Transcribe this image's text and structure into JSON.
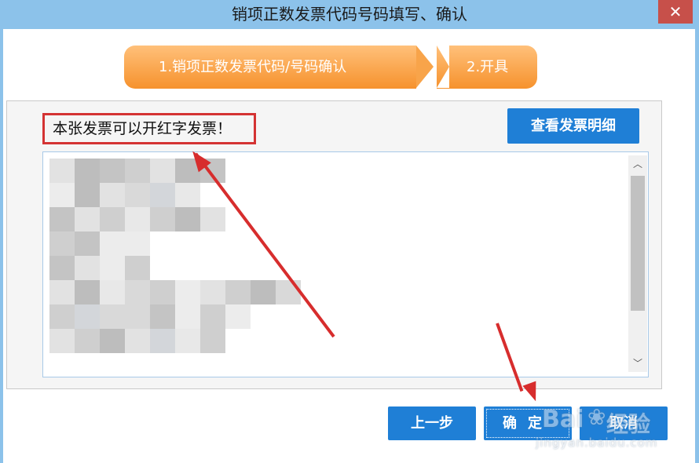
{
  "window": {
    "title": "销项正数发票代码号码填写、确认",
    "close_glyph": "✕"
  },
  "steps": [
    {
      "label": "1.销项正数发票代码/号码确认"
    },
    {
      "label": "2.开具"
    }
  ],
  "notice": {
    "text": "本张发票可以开红字发票！"
  },
  "buttons": {
    "view_detail": "查看发票明细",
    "prev": "上一步",
    "confirm": "确定",
    "cancel": "取消"
  },
  "scrollbar": {
    "up_glyph": "︿",
    "down_glyph": "﹀"
  },
  "watermark": {
    "logo": "Bai",
    "paw": "❀",
    "brand": "经验",
    "url": "jingyan.baidu.com"
  },
  "colors": {
    "titlebar": "#8cc2ea",
    "accent_button": "#1f7fd6",
    "step_orange": "#f6922d",
    "annotation_red": "#d43333"
  }
}
